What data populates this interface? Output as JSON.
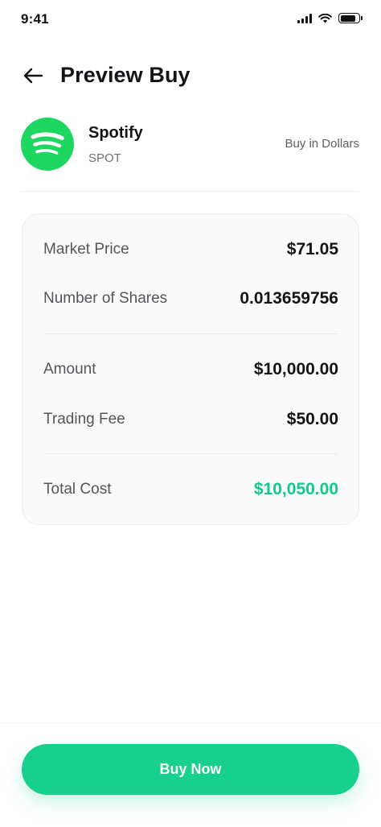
{
  "status_bar": {
    "time": "9:41",
    "signal_icon": "cellular-signal-icon",
    "wifi_icon": "wifi-icon",
    "battery_icon": "battery-icon",
    "battery_level": 0.9
  },
  "header": {
    "back_icon": "arrow-left-icon",
    "title": "Preview Buy"
  },
  "stock": {
    "logo_icon": "spotify-logo-icon",
    "name": "Spotify",
    "ticker": "SPOT",
    "buy_mode": "Buy in Dollars"
  },
  "summary": {
    "market_price": {
      "label": "Market Price",
      "value": "$71.05"
    },
    "shares": {
      "label": "Number of Shares",
      "value": "0.013659756"
    },
    "amount": {
      "label": "Amount",
      "value": "$10,000.00"
    },
    "fee": {
      "label": "Trading Fee",
      "value": "$50.00"
    },
    "total": {
      "label": "Total Cost",
      "value": "$10,050.00"
    }
  },
  "actions": {
    "buy_label": "Buy Now"
  },
  "colors": {
    "accent": "#17D08B",
    "total_text": "#12C98A",
    "spotify_green": "#1ED760",
    "text_primary": "#141418",
    "text_secondary": "#55555B"
  }
}
